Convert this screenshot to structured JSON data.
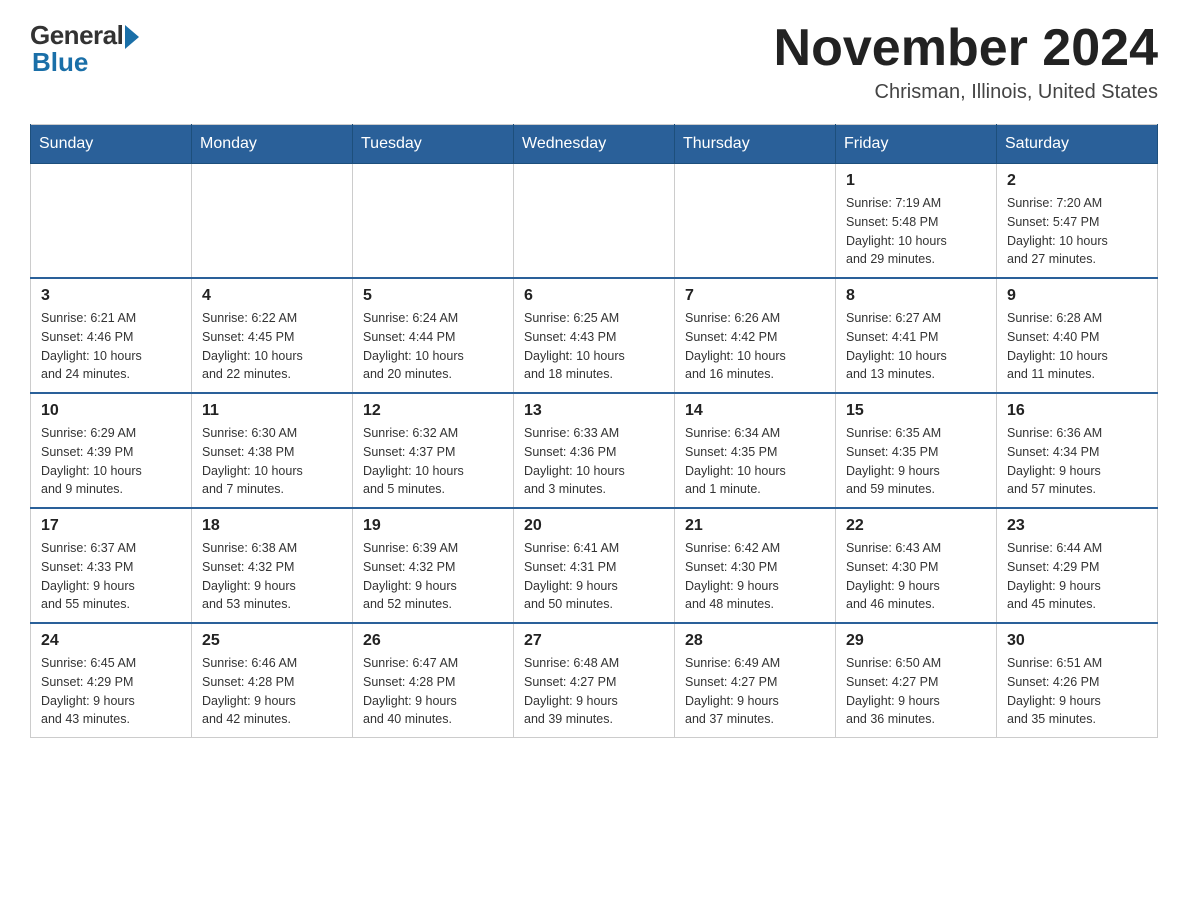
{
  "header": {
    "logo": {
      "general": "General",
      "blue": "Blue"
    },
    "title": "November 2024",
    "subtitle": "Chrisman, Illinois, United States"
  },
  "days_of_week": [
    "Sunday",
    "Monday",
    "Tuesday",
    "Wednesday",
    "Thursday",
    "Friday",
    "Saturday"
  ],
  "weeks": [
    [
      {
        "day": "",
        "info": ""
      },
      {
        "day": "",
        "info": ""
      },
      {
        "day": "",
        "info": ""
      },
      {
        "day": "",
        "info": ""
      },
      {
        "day": "",
        "info": ""
      },
      {
        "day": "1",
        "info": "Sunrise: 7:19 AM\nSunset: 5:48 PM\nDaylight: 10 hours\nand 29 minutes."
      },
      {
        "day": "2",
        "info": "Sunrise: 7:20 AM\nSunset: 5:47 PM\nDaylight: 10 hours\nand 27 minutes."
      }
    ],
    [
      {
        "day": "3",
        "info": "Sunrise: 6:21 AM\nSunset: 4:46 PM\nDaylight: 10 hours\nand 24 minutes."
      },
      {
        "day": "4",
        "info": "Sunrise: 6:22 AM\nSunset: 4:45 PM\nDaylight: 10 hours\nand 22 minutes."
      },
      {
        "day": "5",
        "info": "Sunrise: 6:24 AM\nSunset: 4:44 PM\nDaylight: 10 hours\nand 20 minutes."
      },
      {
        "day": "6",
        "info": "Sunrise: 6:25 AM\nSunset: 4:43 PM\nDaylight: 10 hours\nand 18 minutes."
      },
      {
        "day": "7",
        "info": "Sunrise: 6:26 AM\nSunset: 4:42 PM\nDaylight: 10 hours\nand 16 minutes."
      },
      {
        "day": "8",
        "info": "Sunrise: 6:27 AM\nSunset: 4:41 PM\nDaylight: 10 hours\nand 13 minutes."
      },
      {
        "day": "9",
        "info": "Sunrise: 6:28 AM\nSunset: 4:40 PM\nDaylight: 10 hours\nand 11 minutes."
      }
    ],
    [
      {
        "day": "10",
        "info": "Sunrise: 6:29 AM\nSunset: 4:39 PM\nDaylight: 10 hours\nand 9 minutes."
      },
      {
        "day": "11",
        "info": "Sunrise: 6:30 AM\nSunset: 4:38 PM\nDaylight: 10 hours\nand 7 minutes."
      },
      {
        "day": "12",
        "info": "Sunrise: 6:32 AM\nSunset: 4:37 PM\nDaylight: 10 hours\nand 5 minutes."
      },
      {
        "day": "13",
        "info": "Sunrise: 6:33 AM\nSunset: 4:36 PM\nDaylight: 10 hours\nand 3 minutes."
      },
      {
        "day": "14",
        "info": "Sunrise: 6:34 AM\nSunset: 4:35 PM\nDaylight: 10 hours\nand 1 minute."
      },
      {
        "day": "15",
        "info": "Sunrise: 6:35 AM\nSunset: 4:35 PM\nDaylight: 9 hours\nand 59 minutes."
      },
      {
        "day": "16",
        "info": "Sunrise: 6:36 AM\nSunset: 4:34 PM\nDaylight: 9 hours\nand 57 minutes."
      }
    ],
    [
      {
        "day": "17",
        "info": "Sunrise: 6:37 AM\nSunset: 4:33 PM\nDaylight: 9 hours\nand 55 minutes."
      },
      {
        "day": "18",
        "info": "Sunrise: 6:38 AM\nSunset: 4:32 PM\nDaylight: 9 hours\nand 53 minutes."
      },
      {
        "day": "19",
        "info": "Sunrise: 6:39 AM\nSunset: 4:32 PM\nDaylight: 9 hours\nand 52 minutes."
      },
      {
        "day": "20",
        "info": "Sunrise: 6:41 AM\nSunset: 4:31 PM\nDaylight: 9 hours\nand 50 minutes."
      },
      {
        "day": "21",
        "info": "Sunrise: 6:42 AM\nSunset: 4:30 PM\nDaylight: 9 hours\nand 48 minutes."
      },
      {
        "day": "22",
        "info": "Sunrise: 6:43 AM\nSunset: 4:30 PM\nDaylight: 9 hours\nand 46 minutes."
      },
      {
        "day": "23",
        "info": "Sunrise: 6:44 AM\nSunset: 4:29 PM\nDaylight: 9 hours\nand 45 minutes."
      }
    ],
    [
      {
        "day": "24",
        "info": "Sunrise: 6:45 AM\nSunset: 4:29 PM\nDaylight: 9 hours\nand 43 minutes."
      },
      {
        "day": "25",
        "info": "Sunrise: 6:46 AM\nSunset: 4:28 PM\nDaylight: 9 hours\nand 42 minutes."
      },
      {
        "day": "26",
        "info": "Sunrise: 6:47 AM\nSunset: 4:28 PM\nDaylight: 9 hours\nand 40 minutes."
      },
      {
        "day": "27",
        "info": "Sunrise: 6:48 AM\nSunset: 4:27 PM\nDaylight: 9 hours\nand 39 minutes."
      },
      {
        "day": "28",
        "info": "Sunrise: 6:49 AM\nSunset: 4:27 PM\nDaylight: 9 hours\nand 37 minutes."
      },
      {
        "day": "29",
        "info": "Sunrise: 6:50 AM\nSunset: 4:27 PM\nDaylight: 9 hours\nand 36 minutes."
      },
      {
        "day": "30",
        "info": "Sunrise: 6:51 AM\nSunset: 4:26 PM\nDaylight: 9 hours\nand 35 minutes."
      }
    ]
  ]
}
